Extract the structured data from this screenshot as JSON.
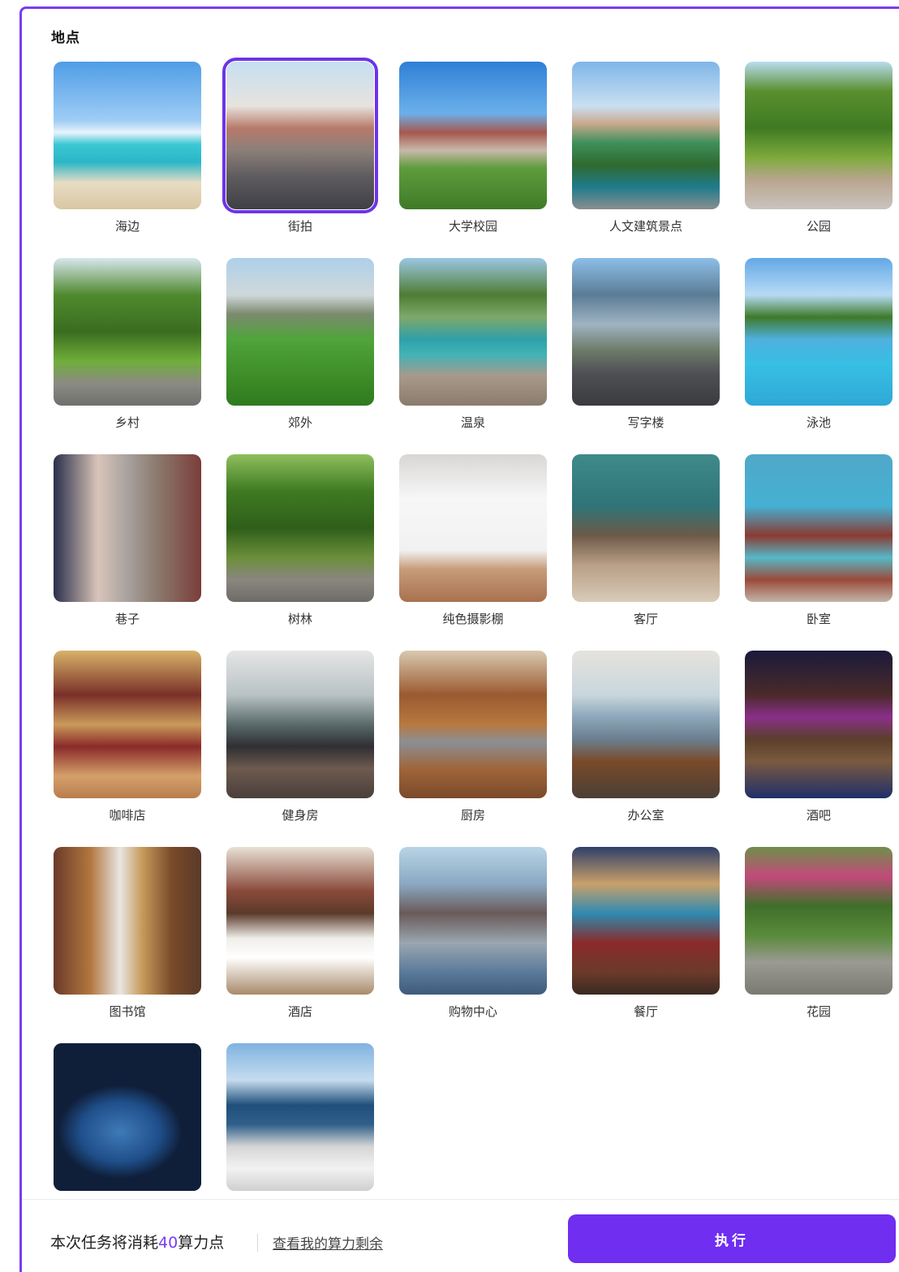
{
  "section": {
    "title": "地点"
  },
  "locations": [
    {
      "label": "海边",
      "scene": "beach",
      "selected": false
    },
    {
      "label": "街拍",
      "scene": "street",
      "selected": true
    },
    {
      "label": "大学校园",
      "scene": "campus",
      "selected": false
    },
    {
      "label": "人文建筑景点",
      "scene": "landmark",
      "selected": false
    },
    {
      "label": "公园",
      "scene": "park",
      "selected": false
    },
    {
      "label": "乡村",
      "scene": "village",
      "selected": false
    },
    {
      "label": "郊外",
      "scene": "suburb",
      "selected": false
    },
    {
      "label": "温泉",
      "scene": "hotspring",
      "selected": false
    },
    {
      "label": "写字楼",
      "scene": "office-tower",
      "selected": false
    },
    {
      "label": "泳池",
      "scene": "pool",
      "selected": false
    },
    {
      "label": "巷子",
      "scene": "alley",
      "selected": false
    },
    {
      "label": "树林",
      "scene": "forest",
      "selected": false
    },
    {
      "label": "纯色摄影棚",
      "scene": "studio",
      "selected": false
    },
    {
      "label": "客厅",
      "scene": "living-room",
      "selected": false
    },
    {
      "label": "卧室",
      "scene": "bedroom",
      "selected": false
    },
    {
      "label": "咖啡店",
      "scene": "cafe",
      "selected": false
    },
    {
      "label": "健身房",
      "scene": "gym",
      "selected": false
    },
    {
      "label": "厨房",
      "scene": "kitchen",
      "selected": false
    },
    {
      "label": "办公室",
      "scene": "office",
      "selected": false
    },
    {
      "label": "酒吧",
      "scene": "bar",
      "selected": false
    },
    {
      "label": "图书馆",
      "scene": "library",
      "selected": false
    },
    {
      "label": "酒店",
      "scene": "hotel",
      "selected": false
    },
    {
      "label": "购物中心",
      "scene": "mall",
      "selected": false
    },
    {
      "label": "餐厅",
      "scene": "restaurant",
      "selected": false
    },
    {
      "label": "花园",
      "scene": "garden",
      "selected": false
    },
    {
      "label": "",
      "scene": "spaceship",
      "selected": false
    },
    {
      "label": "",
      "scene": "yacht",
      "selected": false
    }
  ],
  "footer": {
    "cost_prefix": "本次任务将消耗",
    "cost_value": "40",
    "cost_suffix": "算力点",
    "balance_link": "查看我的算力剩余",
    "run_label": "执行"
  },
  "colors": {
    "accent": "#6f2ef0",
    "selected_border": "#6d34e8"
  }
}
